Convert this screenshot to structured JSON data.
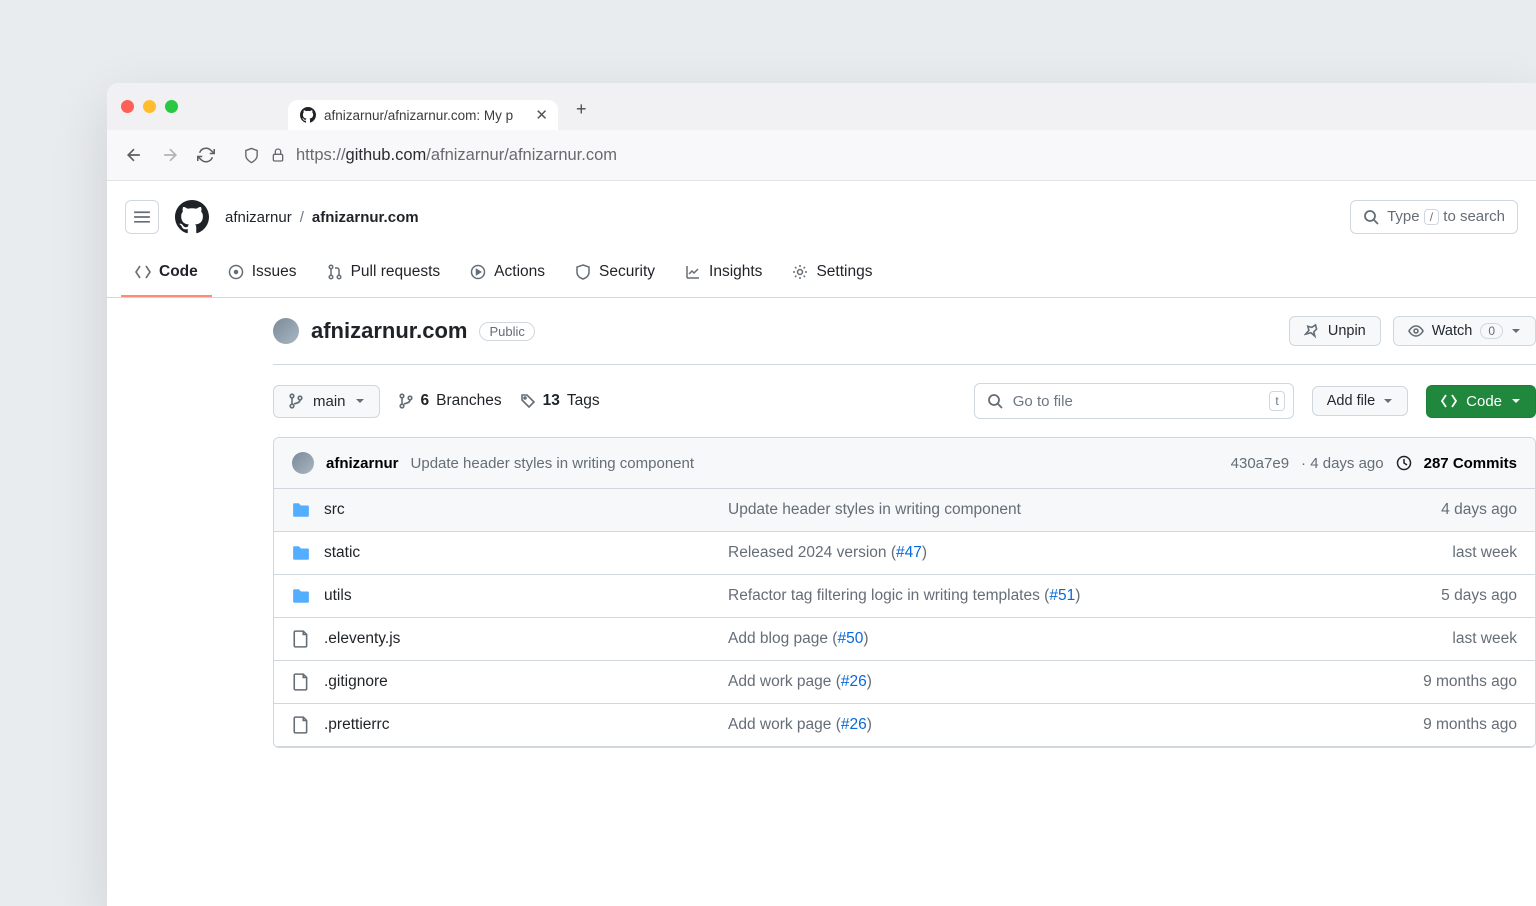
{
  "browser": {
    "tab_title": "afnizarnur/afnizarnur.com: My p",
    "url_prefix": "https://",
    "url_host": "github.com",
    "url_path": "/afnizarnur/afnizarnur.com"
  },
  "header": {
    "owner": "afnizarnur",
    "repo": "afnizarnur.com",
    "search_prompt_before": "Type ",
    "search_key": "/",
    "search_prompt_after": " to search"
  },
  "tabs": [
    {
      "label": "Code",
      "id": "code",
      "active": true
    },
    {
      "label": "Issues",
      "id": "issues"
    },
    {
      "label": "Pull requests",
      "id": "pulls"
    },
    {
      "label": "Actions",
      "id": "actions"
    },
    {
      "label": "Security",
      "id": "security"
    },
    {
      "label": "Insights",
      "id": "insights"
    },
    {
      "label": "Settings",
      "id": "settings"
    }
  ],
  "repo": {
    "title": "afnizarnur.com",
    "visibility": "Public",
    "unpin_label": "Unpin",
    "watch_label": "Watch",
    "watch_count": "0",
    "branch": "main",
    "branch_count": "6",
    "branch_label": "Branches",
    "tag_count": "13",
    "tag_label": "Tags",
    "goto_placeholder": "Go to file",
    "goto_key": "t",
    "addfile_label": "Add file",
    "code_label": "Code"
  },
  "commit": {
    "author": "afnizarnur",
    "message": "Update header styles in writing component",
    "sha": "430a7e9",
    "ago": "4 days ago",
    "commits_count": "287",
    "commits_label": "Commits"
  },
  "files": [
    {
      "type": "folder",
      "name": "src",
      "msg": "Update header styles in writing component",
      "pr": "",
      "ago": "4 days ago"
    },
    {
      "type": "folder",
      "name": "static",
      "msg": "Released 2024 version (",
      "pr": "#47",
      "after": ")",
      "ago": "last week"
    },
    {
      "type": "folder",
      "name": "utils",
      "msg": "Refactor tag filtering logic in writing templates (",
      "pr": "#51",
      "after": ")",
      "ago": "5 days ago"
    },
    {
      "type": "file",
      "name": ".eleventy.js",
      "msg": "Add blog page (",
      "pr": "#50",
      "after": ")",
      "ago": "last week"
    },
    {
      "type": "file",
      "name": ".gitignore",
      "msg": "Add work page (",
      "pr": "#26",
      "after": ")",
      "ago": "9 months ago"
    },
    {
      "type": "file",
      "name": ".prettierrc",
      "msg": "Add work page (",
      "pr": "#26",
      "after": ")",
      "ago": "9 months ago"
    }
  ]
}
